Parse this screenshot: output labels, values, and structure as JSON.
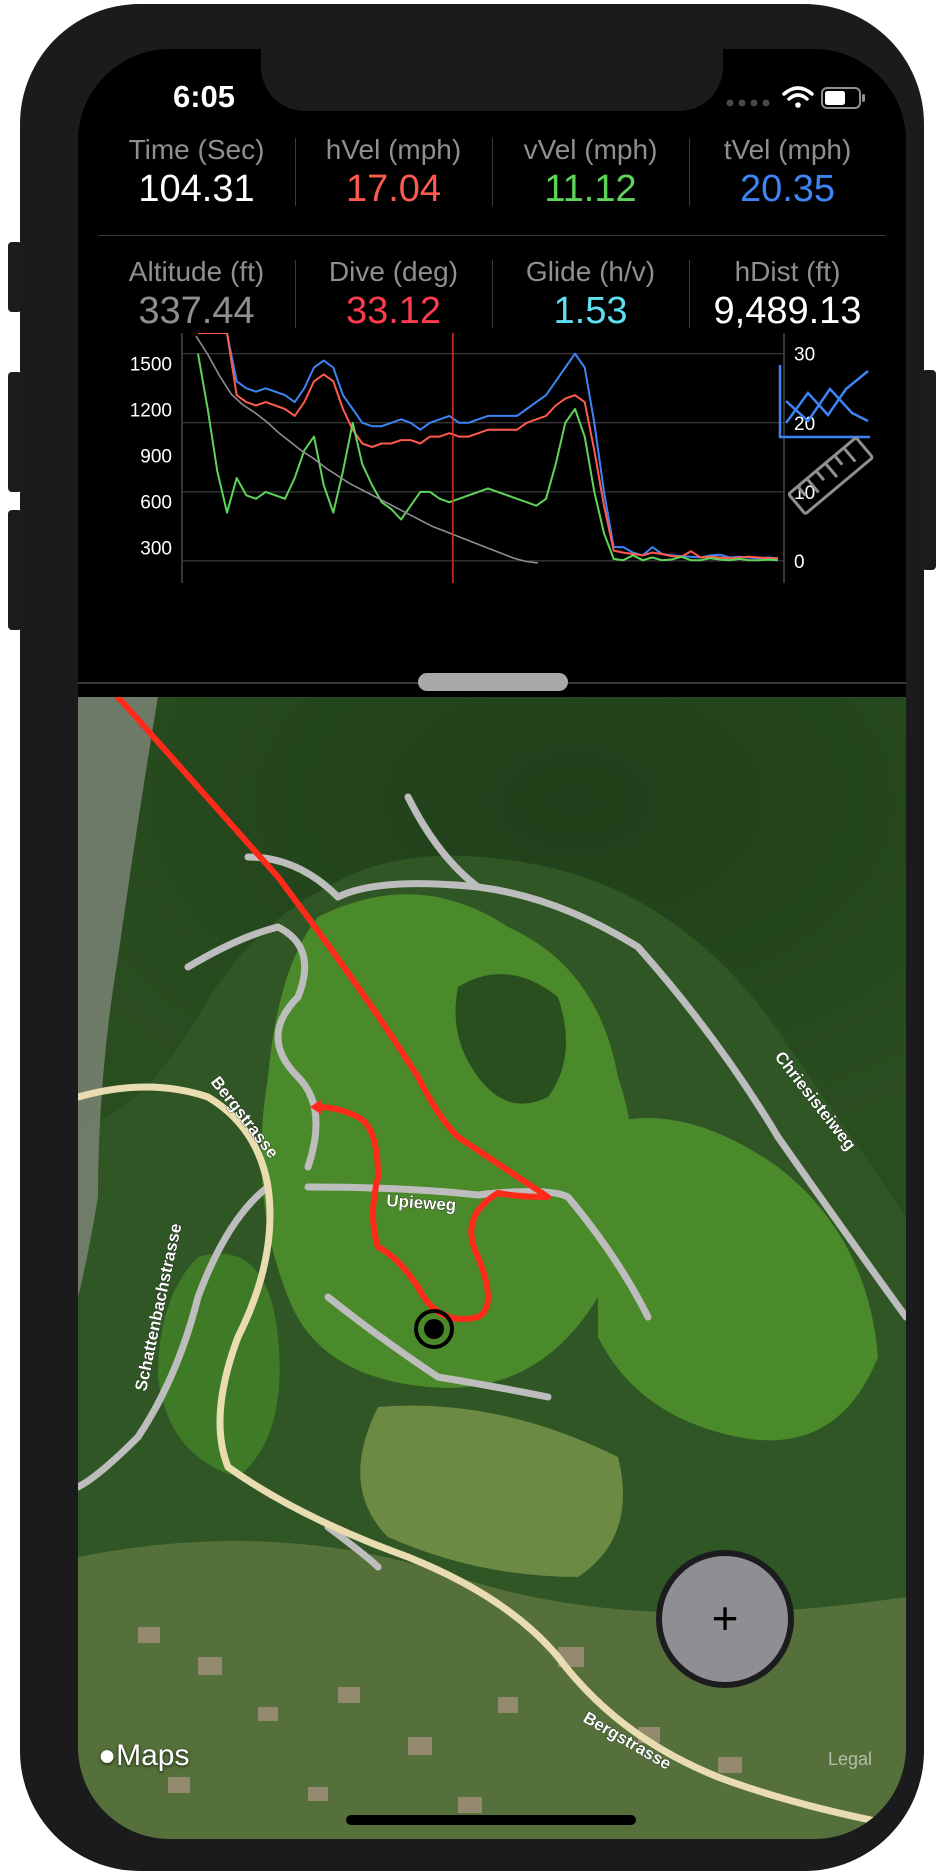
{
  "status_bar": {
    "time": "6:05"
  },
  "metrics": [
    [
      {
        "label": "Time (Sec)",
        "value": "104.31",
        "color": "#ffffff"
      },
      {
        "label": "hVel (mph)",
        "value": "17.04",
        "color": "#ff5a4e"
      },
      {
        "label": "vVel (mph)",
        "value": "11.12",
        "color": "#5ed45a"
      },
      {
        "label": "tVel (mph)",
        "value": "20.35",
        "color": "#3d84f5"
      }
    ],
    [
      {
        "label": "Altitude (ft)",
        "value": "337.44",
        "color": "#8e8e93"
      },
      {
        "label": "Dive (deg)",
        "value": "33.12",
        "color": "#ff3b4e"
      },
      {
        "label": "Glide (h/v)",
        "value": "1.53",
        "color": "#5ee0f0"
      },
      {
        "label": "hDist (ft)",
        "value": "9,489.13",
        "color": "#ffffff"
      }
    ]
  ],
  "chart_data": {
    "type": "line",
    "left_axis": {
      "ticks": [
        "1500",
        "1200",
        "900",
        "600",
        "300"
      ],
      "ylim": [
        200,
        1700
      ]
    },
    "right_axis": {
      "ticks": [
        "30",
        "20",
        "10",
        "0"
      ],
      "ylim": [
        -0.3,
        33
      ]
    },
    "grid": true,
    "cursor_x": 0.45,
    "series": [
      {
        "color": "#3d84f5",
        "values": [
          33,
          33,
          33,
          33,
          26,
          25,
          24.5,
          25,
          24.5,
          24,
          23,
          25,
          28,
          29,
          28,
          24,
          22,
          20,
          19.5,
          19.5,
          20,
          20.5,
          20,
          19,
          20,
          20.5,
          21,
          20,
          20,
          20.5,
          21,
          21,
          21,
          21,
          22,
          23,
          24,
          26,
          28,
          30,
          28,
          20,
          10,
          2,
          2,
          1.2,
          0.8,
          2,
          1.0,
          0.8,
          0.7,
          0.6,
          0.5,
          0.8,
          0.9,
          0.5,
          0.6,
          0.5,
          0.4,
          0.5,
          0.4
        ]
      },
      {
        "color": "#ff5a4e",
        "values": [
          33,
          33,
          33,
          33,
          24,
          23,
          22.5,
          23,
          22.5,
          22,
          21,
          23,
          26,
          27,
          26,
          22,
          19,
          17,
          16.5,
          17,
          17,
          17.5,
          17.5,
          17,
          18,
          18,
          18.5,
          18,
          18,
          18.5,
          19,
          19,
          19,
          19,
          20,
          20.5,
          21,
          22.5,
          23.5,
          24,
          23,
          16,
          8,
          1.5,
          1.2,
          1.0,
          0.8,
          1.2,
          1.0,
          0.7,
          0.6,
          1.4,
          0.5,
          0.6,
          0.5,
          0.4,
          0.5,
          0.6,
          0.5,
          0.4,
          0.4
        ]
      },
      {
        "color": "#5ed45a",
        "values": [
          30,
          22,
          13,
          7,
          12,
          9.5,
          9,
          10,
          9.5,
          9,
          12,
          16,
          18,
          11,
          7,
          13,
          20,
          14,
          11,
          8.5,
          7.5,
          6,
          8,
          10,
          10,
          9,
          8.5,
          9,
          9.5,
          10,
          10.5,
          10,
          9.5,
          9,
          8.5,
          8,
          9,
          14,
          20,
          22,
          18,
          10,
          4,
          0.3,
          0.1,
          0.8,
          0.1,
          0.5,
          0.1,
          0.2,
          0.6,
          0.1,
          0.1,
          0.4,
          0.2,
          0.1,
          0.3,
          0.1,
          0.1,
          0.2,
          0.1
        ]
      },
      {
        "color": "#8e8e93",
        "values": [
          1680,
          1560,
          1420,
          1300,
          1230,
          1180,
          1120,
          1050,
          990,
          930,
          880,
          820,
          770,
          720,
          680,
          640,
          600,
          560,
          520,
          480,
          440,
          410,
          380,
          350,
          320,
          290,
          260,
          230,
          210,
          200
        ]
      }
    ]
  },
  "icons": {
    "chart": "line-chart-icon",
    "ruler": "ruler-icon"
  },
  "map": {
    "labels": [
      "Bergstrasse",
      "Upieweg",
      "Chriesisteiweg",
      "Schattenbachstrasse",
      "Bergstrasse"
    ],
    "attribution": "Maps",
    "legal": "Legal"
  },
  "fab": {
    "label": "+"
  }
}
